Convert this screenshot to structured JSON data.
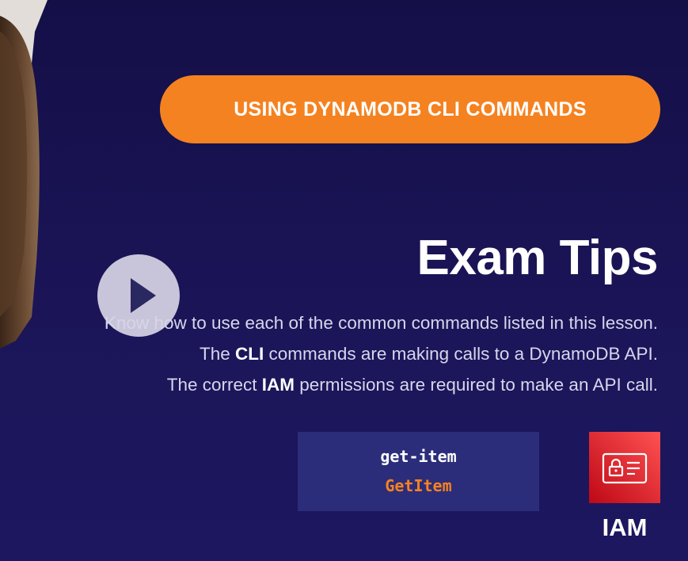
{
  "slide": {
    "title_pill": "USING DYNAMODB CLI COMMANDS",
    "heading": "Exam Tips",
    "tips": [
      {
        "before": "Know how to use each of the common commands listed in this lesson.",
        "bold": "",
        "after": ""
      },
      {
        "before": "The ",
        "bold": "CLI",
        "after": " commands are making calls to a DynamoDB API."
      },
      {
        "before": "The correct ",
        "bold": "IAM",
        "after": " permissions are required to make an API call."
      }
    ],
    "command_box": {
      "cli_command": "get-item",
      "api_call": "GetItem"
    },
    "iam": {
      "icon": "iam-badge-icon",
      "label": "IAM"
    }
  },
  "player": {
    "play_icon": "play-icon"
  },
  "colors": {
    "background": "#17124f",
    "accent_orange": "#f58220",
    "command_box": "#2b2d7a",
    "iam_red": "#dd344c"
  }
}
